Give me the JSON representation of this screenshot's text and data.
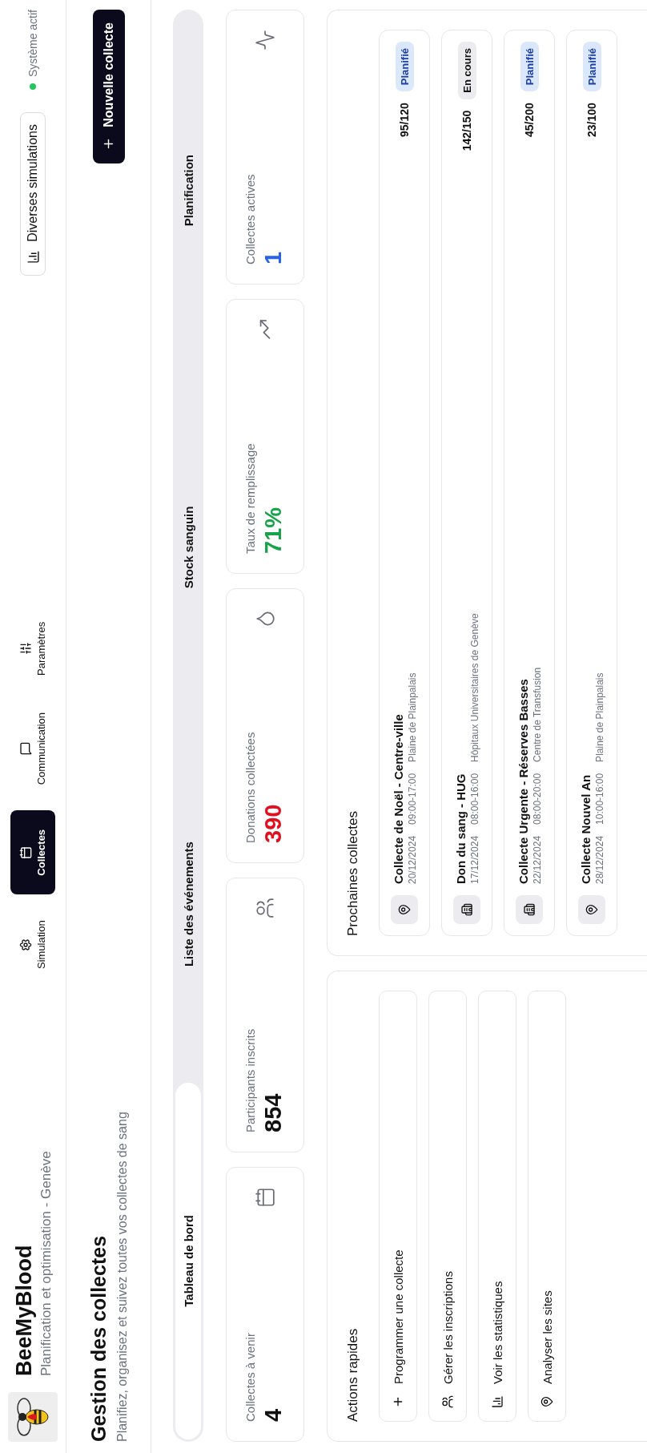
{
  "app": {
    "title": "BeeMyBlood",
    "subtitle": "Planification et optimisation - Genève"
  },
  "nav": [
    {
      "label": "Simulation",
      "selected": false
    },
    {
      "label": "Collectes",
      "selected": true
    },
    {
      "label": "Communication",
      "selected": false
    },
    {
      "label": "Paramètres",
      "selected": false
    }
  ],
  "simulations_button": "Diverses simulations",
  "system_status": {
    "label": "Système actif",
    "active": true
  },
  "page": {
    "title": "Gestion des collectes",
    "subtitle": "Planifiez, organisez et suivez toutes vos collectes de sang",
    "new_button": "Nouvelle collecte"
  },
  "tabs": [
    {
      "label": "Tableau de bord",
      "selected": true
    },
    {
      "label": "Liste des événements",
      "selected": false
    },
    {
      "label": "Stock sanguin",
      "selected": false
    },
    {
      "label": "Planification",
      "selected": false
    }
  ],
  "stats": [
    {
      "label": "Collectes à venir",
      "value": "4",
      "color": "#111111"
    },
    {
      "label": "Participants inscrits",
      "value": "854",
      "color": "#111111"
    },
    {
      "label": "Donations collectées",
      "value": "390",
      "color": "#e0101e"
    },
    {
      "label": "Taux de remplissage",
      "value": "71%",
      "color": "#16a34a"
    },
    {
      "label": "Collectes actives",
      "value": "1",
      "color": "#2563eb"
    }
  ],
  "quick_actions": {
    "title": "Actions rapides",
    "items": [
      "Programmer une collecte",
      "Gérer les inscriptions",
      "Voir les statistiques",
      "Analyser les sites"
    ]
  },
  "upcoming": {
    "title": "Prochaines collectes",
    "items": [
      {
        "kind": "site",
        "name": "Collecte de Noël - Centre-ville",
        "date": "20/12/2024",
        "time": "09:00-17:00",
        "place": "Plaine de Plainpalais",
        "count": "95/120",
        "status": "Planifié",
        "color": "#dbe7fb"
      },
      {
        "kind": "building",
        "name": "Don du sang - HUG",
        "date": "17/12/2024",
        "time": "08:00-16:00",
        "place": "Hôpitaux Universitaires de Genève",
        "count": "142/150",
        "status": "En cours",
        "color": "#ececf0"
      },
      {
        "kind": "building",
        "name": "Collecte Urgente - Réserves Basses",
        "date": "22/12/2024",
        "time": "08:00-20:00",
        "place": "Centre de Transfusion",
        "count": "45/200",
        "status": "Planifié",
        "color": "#dbe7fb"
      },
      {
        "kind": "site",
        "name": "Collecte Nouvel An",
        "date": "28/12/2024",
        "time": "10:00-16:00",
        "place": "Plaine de Plainpalais",
        "count": "23/100",
        "status": "Planifié",
        "color": "#dbe7fb"
      }
    ]
  }
}
